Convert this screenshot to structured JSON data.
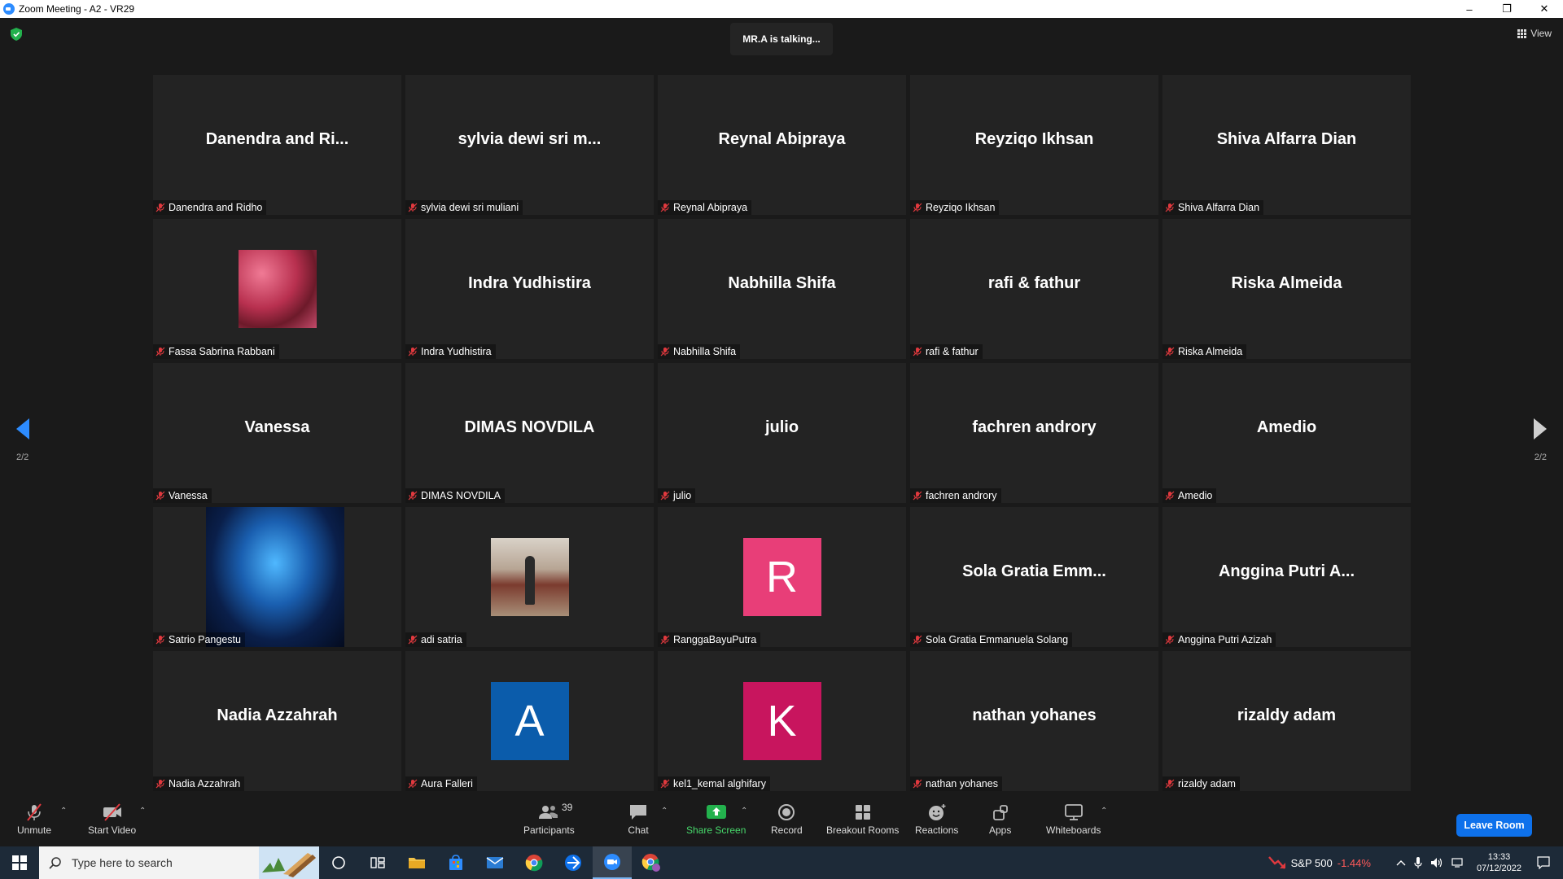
{
  "window": {
    "title": "Zoom Meeting - A2 - VR29",
    "minimize": "–",
    "restore": "❐",
    "close": "✕"
  },
  "meeting": {
    "talking_indicator": "MR.A is talking...",
    "view_label": "View",
    "page_indicator": "2/2"
  },
  "tiles": [
    {
      "display": "Danendra and Ri...",
      "label": "Danendra and Ridho"
    },
    {
      "display": "sylvia dewi sri m...",
      "label": "sylvia dewi sri muliani"
    },
    {
      "display": "Reynal Abipraya",
      "label": "Reynal Abipraya"
    },
    {
      "display": "Reyziqo Ikhsan",
      "label": "Reyziqo Ikhsan"
    },
    {
      "display": "Shiva Alfarra Dian",
      "label": "Shiva Alfarra Dian"
    },
    {
      "display": "",
      "label": "Fassa Sabrina Rabbani",
      "avatar": "photo-pink"
    },
    {
      "display": "Indra Yudhistira",
      "label": "Indra Yudhistira"
    },
    {
      "display": "Nabhilla Shifa",
      "label": "Nabhilla Shifa"
    },
    {
      "display": "rafi & fathur",
      "label": "rafi & fathur"
    },
    {
      "display": "Riska Almeida",
      "label": "Riska Almeida"
    },
    {
      "display": "Vanessa",
      "label": "Vanessa"
    },
    {
      "display": "DIMAS NOVDILA",
      "label": "DIMAS NOVDILA"
    },
    {
      "display": "julio",
      "label": "julio"
    },
    {
      "display": "fachren androry",
      "label": "fachren androry"
    },
    {
      "display": "Amedio",
      "label": "Amedio"
    },
    {
      "display": "",
      "label": "Satrio Pangestu",
      "avatar": "photo-blue-globe"
    },
    {
      "display": "",
      "label": "adi satria",
      "avatar": "photo-person"
    },
    {
      "display": "R",
      "label": "RanggaBayuPutra",
      "avatar": "letter",
      "color": "#e83e78"
    },
    {
      "display": "Sola Gratia Emm...",
      "label": "Sola Gratia Emmanuela Solang"
    },
    {
      "display": "Anggina Putri A...",
      "label": "Anggina Putri Azizah"
    },
    {
      "display": "Nadia Azzahrah",
      "label": "Nadia Azzahrah"
    },
    {
      "display": "A",
      "label": "Aura Falleri",
      "avatar": "letter",
      "color": "#0b5cab"
    },
    {
      "display": "K",
      "label": "kel1_kemal alghifary",
      "avatar": "letter",
      "color": "#c8155e"
    },
    {
      "display": "nathan yohanes",
      "label": "nathan yohanes"
    },
    {
      "display": "rizaldy adam",
      "label": "rizaldy adam"
    }
  ],
  "toolbar": {
    "unmute": "Unmute",
    "start_video": "Start Video",
    "participants": "Participants",
    "participants_count": "39",
    "chat": "Chat",
    "share_screen": "Share Screen",
    "record": "Record",
    "breakout_rooms": "Breakout Rooms",
    "reactions": "Reactions",
    "apps": "Apps",
    "whiteboards": "Whiteboards",
    "leave_room": "Leave Room",
    "colors": {
      "share": "#47d96b",
      "leave": "#0e71eb",
      "mic_off": "#e0393e"
    }
  },
  "taskbar": {
    "search_placeholder": "Type here to search",
    "stock_name": "S&P 500",
    "stock_change": "-1.44%",
    "time": "13:33",
    "date": "07/12/2022"
  }
}
